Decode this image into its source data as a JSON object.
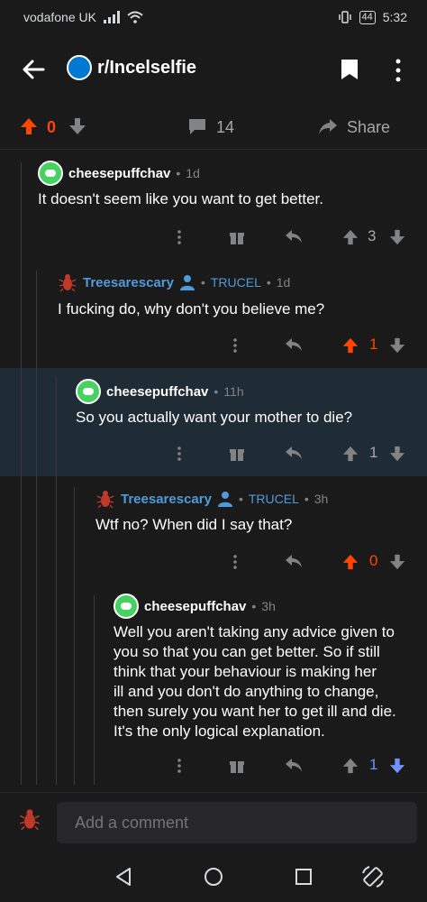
{
  "status": {
    "carrier": "vodafone UK",
    "battery": "44",
    "time": "5:32"
  },
  "header": {
    "subreddit": "r/Incelselfie"
  },
  "post_actions": {
    "score": "0",
    "comments": "14",
    "share": "Share"
  },
  "comments": [
    {
      "user": "cheesepuffchav",
      "age": "1d",
      "body": "It doesn't seem like you want to get better.",
      "votes": "3"
    },
    {
      "user": "Treesarescary",
      "flair": "TRUCEL",
      "age": "1d",
      "body": "I fucking do, why don't you believe me?",
      "votes": "1"
    },
    {
      "user": "cheesepuffchav",
      "age": "11h",
      "body": "So you actually want your mother to die?",
      "votes": "1"
    },
    {
      "user": "Treesarescary",
      "flair": "TRUCEL",
      "age": "3h",
      "body": "Wtf no? When did I say that?",
      "votes": "0"
    },
    {
      "user": "cheesepuffchav",
      "age": "3h",
      "body_lines": [
        "Well you aren't taking any advice given to",
        "you so that you can get better. So if still",
        "think that your behaviour is making her",
        "ill and you don't do anything to change,",
        "then surely you want her to get ill and die.",
        "It's the only logical explanation."
      ],
      "votes": "1"
    }
  ],
  "composer": {
    "placeholder": "Add a comment"
  },
  "separator": "•",
  "colors": {
    "upvote": "#ff4500",
    "downvote": "#7193ff",
    "link": "#4f9bd9"
  },
  "icons": [
    "back-arrow-icon",
    "subreddit-icon",
    "bookmark-icon",
    "more-icon",
    "upvote-icon",
    "downvote-icon",
    "comment-icon",
    "share-icon",
    "award-icon",
    "reply-icon",
    "person-icon"
  ]
}
